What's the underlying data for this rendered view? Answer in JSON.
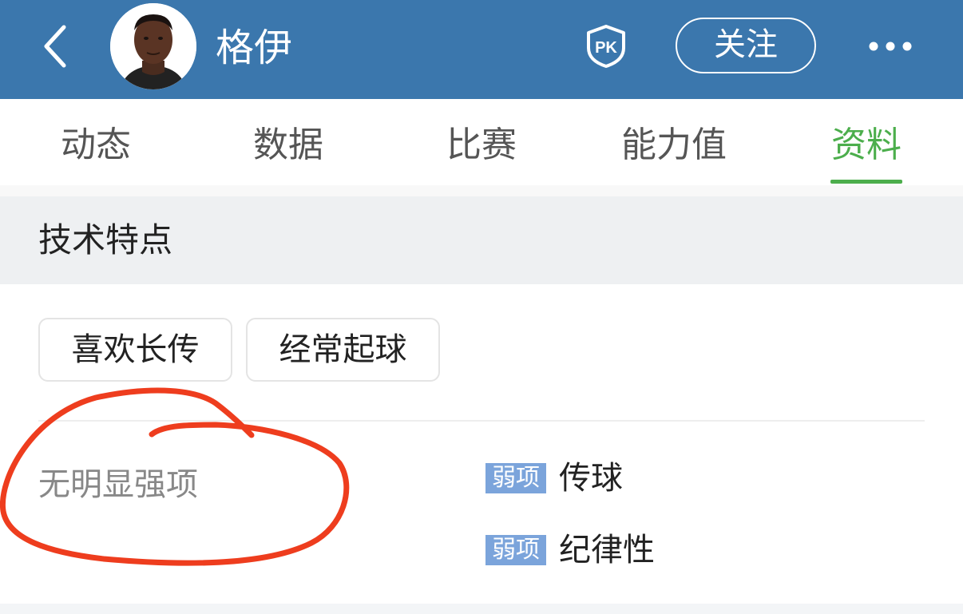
{
  "header": {
    "title": "格伊",
    "pk_label": "PK",
    "follow_label": "关注",
    "icons": [
      "back-chevron-icon",
      "player-avatar",
      "pk-icon",
      "more-icon"
    ],
    "background_color": "#3b77ad"
  },
  "tabs": {
    "items": [
      {
        "label": "动态",
        "active": false
      },
      {
        "label": "数据",
        "active": false
      },
      {
        "label": "比赛",
        "active": false
      },
      {
        "label": "能力值",
        "active": false
      },
      {
        "label": "资料",
        "active": true
      }
    ],
    "active_color": "#4cae4c"
  },
  "section": {
    "title": "技术特点",
    "tags": [
      "喜欢长传",
      "经常起球"
    ],
    "strengths_text": "无明显强项",
    "weaknesses": [
      {
        "badge": "弱项",
        "text": "传球"
      },
      {
        "badge": "弱项",
        "text": "纪律性"
      }
    ],
    "weak_badge_color": "#7ba4db"
  },
  "annotation": {
    "shape": "hand-drawn-circle",
    "color": "#ee3d1e"
  }
}
